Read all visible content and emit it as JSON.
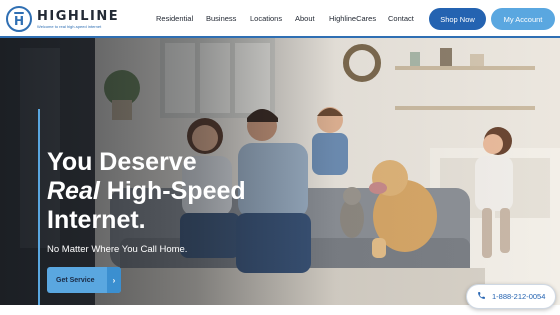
{
  "brand": {
    "name": "HIGHLINE",
    "tagline": "Welcome to real high-speed internet",
    "letter": "H"
  },
  "nav": {
    "items": [
      "Residential",
      "Business",
      "Locations",
      "About",
      "HighlineCares",
      "Contact"
    ]
  },
  "header_buttons": {
    "shop": "Shop Now",
    "account": "My Account"
  },
  "hero": {
    "headline_line1": "You Deserve",
    "headline_em": "Real",
    "headline_line2_rest": " High-Speed",
    "headline_line3": "Internet.",
    "subhead": "No Matter Where You Call Home.",
    "cta": "Get Service",
    "cta_arrow": "›"
  },
  "phone": {
    "number": "1-888-212-0054",
    "icon": "phone-icon"
  },
  "colors": {
    "primary": "#2463b1",
    "accent": "#5aa7e0",
    "dark": "#232a35"
  }
}
